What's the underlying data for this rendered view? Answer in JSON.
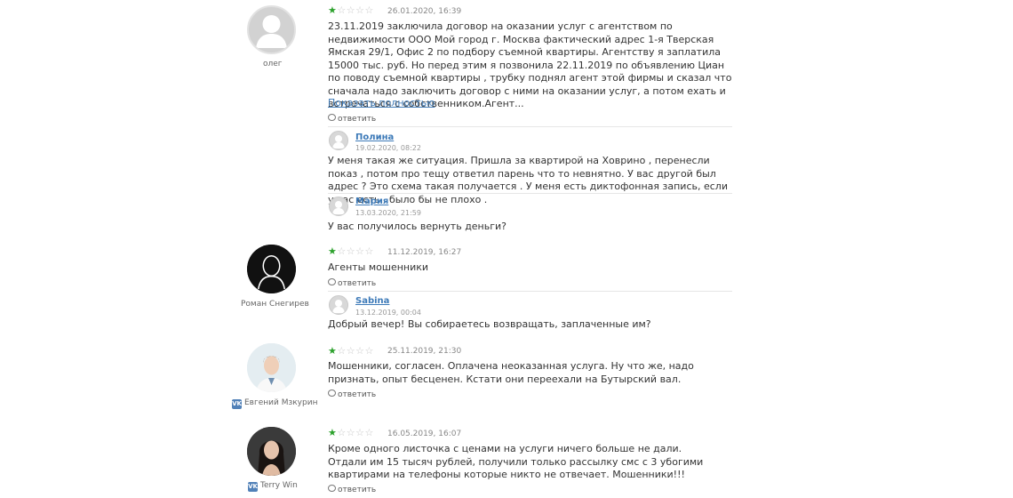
{
  "reviews": [
    {
      "author": "олег",
      "rating": 1,
      "max_rating": 5,
      "date": "26.01.2020, 16:39",
      "text": "23.11.2019 заключила договор на оказании услуг с агентством по недвижимости ООО Мой город г. Москва фактический адрес 1-я Тверская Ямская 29/1, Офис 2 по подбору съемной квартиры. Агентству я заплатила 15000 тыс. руб. Но перед этим я позвонила 22.11.2019 по объявлению Циан по поводу съемной квартиры , трубку поднял агент этой фирмы и сказал что сначала надо заключить договор с ними на оказании услуг, а потом ехать и встречаться с собственником.Агент...",
      "more_label": "Показать полностью",
      "reply_label": "ответить",
      "comments": [
        {
          "name": "Полина",
          "date": "19.02.2020, 08:22",
          "text": "У меня такая же ситуация. Пришла за квартирой на Ховрино , перенесли показ , потом про тещу ответил парень что то невнятно. У вас другой был адрес ? Это схема такая получается . У меня есть диктофонная запись, если у вас есть , было бы не плохо ."
        },
        {
          "name": "Мария",
          "date": "13.03.2020, 21:59",
          "text": "У вас получилось вернуть деньги?"
        }
      ]
    },
    {
      "author": "Роман Снегирев",
      "rating": 1,
      "max_rating": 5,
      "date": "11.12.2019, 16:27",
      "text": "Агенты мошенники",
      "reply_label": "ответить",
      "comments": [
        {
          "name": "Sabina",
          "date": "13.12.2019, 00:04",
          "text": "Добрый вечер! Вы собираетесь возвращать, заплаченные им?"
        }
      ]
    },
    {
      "author": "Евгений Мзкурин",
      "rating": 1,
      "max_rating": 5,
      "date": "25.11.2019, 21:30",
      "text": "Мошенники, согласен. Оплачена неоказанная услуга. Ну что же, надо признать, опыт бесценен. Кстати они переехали на Бутырский вал.",
      "reply_label": "ответить"
    },
    {
      "author": "Terry Win",
      "rating": 1,
      "max_rating": 5,
      "date": "16.05.2019, 16:07",
      "text": "Кроме одного листочка с ценами на услуги ничего больше не дали. Отдали им 15 тысяч рублей, получили только рассылку смс с 3 убогими квартирами на телефоны которые никто не отвечает. Мошенники!!!",
      "reply_label": "ответить"
    }
  ],
  "colors": {
    "star": "#2ca12c",
    "link": "#3d7ab8",
    "vk": "#5181b8"
  },
  "icons": {
    "vk": "vk-icon",
    "reply": "speech-bubble-icon",
    "star": "star-icon"
  }
}
